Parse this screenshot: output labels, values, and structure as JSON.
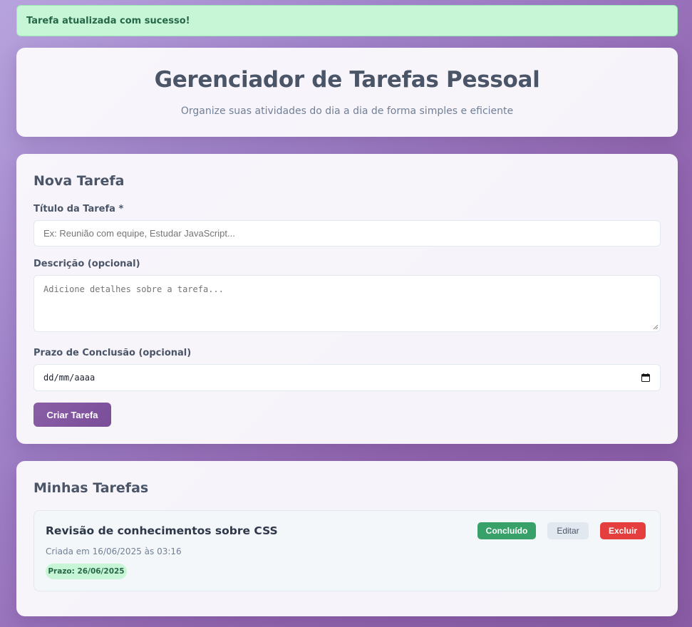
{
  "alert": {
    "message": "Tarefa atualizada com sucesso!"
  },
  "header": {
    "title": "Gerenciador de Tarefas Pessoal",
    "subtitle": "Organize suas atividades do dia a dia de forma simples e eficiente"
  },
  "form": {
    "section_title": "Nova Tarefa",
    "title_label": "Título da Tarefa *",
    "title_placeholder": "Ex: Reunião com equipe, Estudar JavaScript...",
    "description_label": "Descrição (opcional)",
    "description_placeholder": "Adicione detalhes sobre a tarefa...",
    "deadline_label": "Prazo de Conclusão (opcional)",
    "deadline_value": "dd/mm/aaaa",
    "submit_label": "Criar Tarefa"
  },
  "list": {
    "section_title": "Minhas Tarefas",
    "tasks": [
      {
        "title": "Revisão de conhecimentos sobre CSS",
        "created": "Criada em 16/06/2025 às 03:16",
        "deadline": "Prazo: 26/06/2025",
        "done_label": "Concluído",
        "edit_label": "Editar",
        "delete_label": "Excluir"
      }
    ]
  },
  "colors": {
    "accent": "#7a4d98",
    "success": "#38a169",
    "danger": "#e53e3e",
    "success_bg": "#c6f6d5"
  },
  "icons": {
    "date_picker": "calendar-icon",
    "textarea_grip": "resize-grip-icon"
  }
}
